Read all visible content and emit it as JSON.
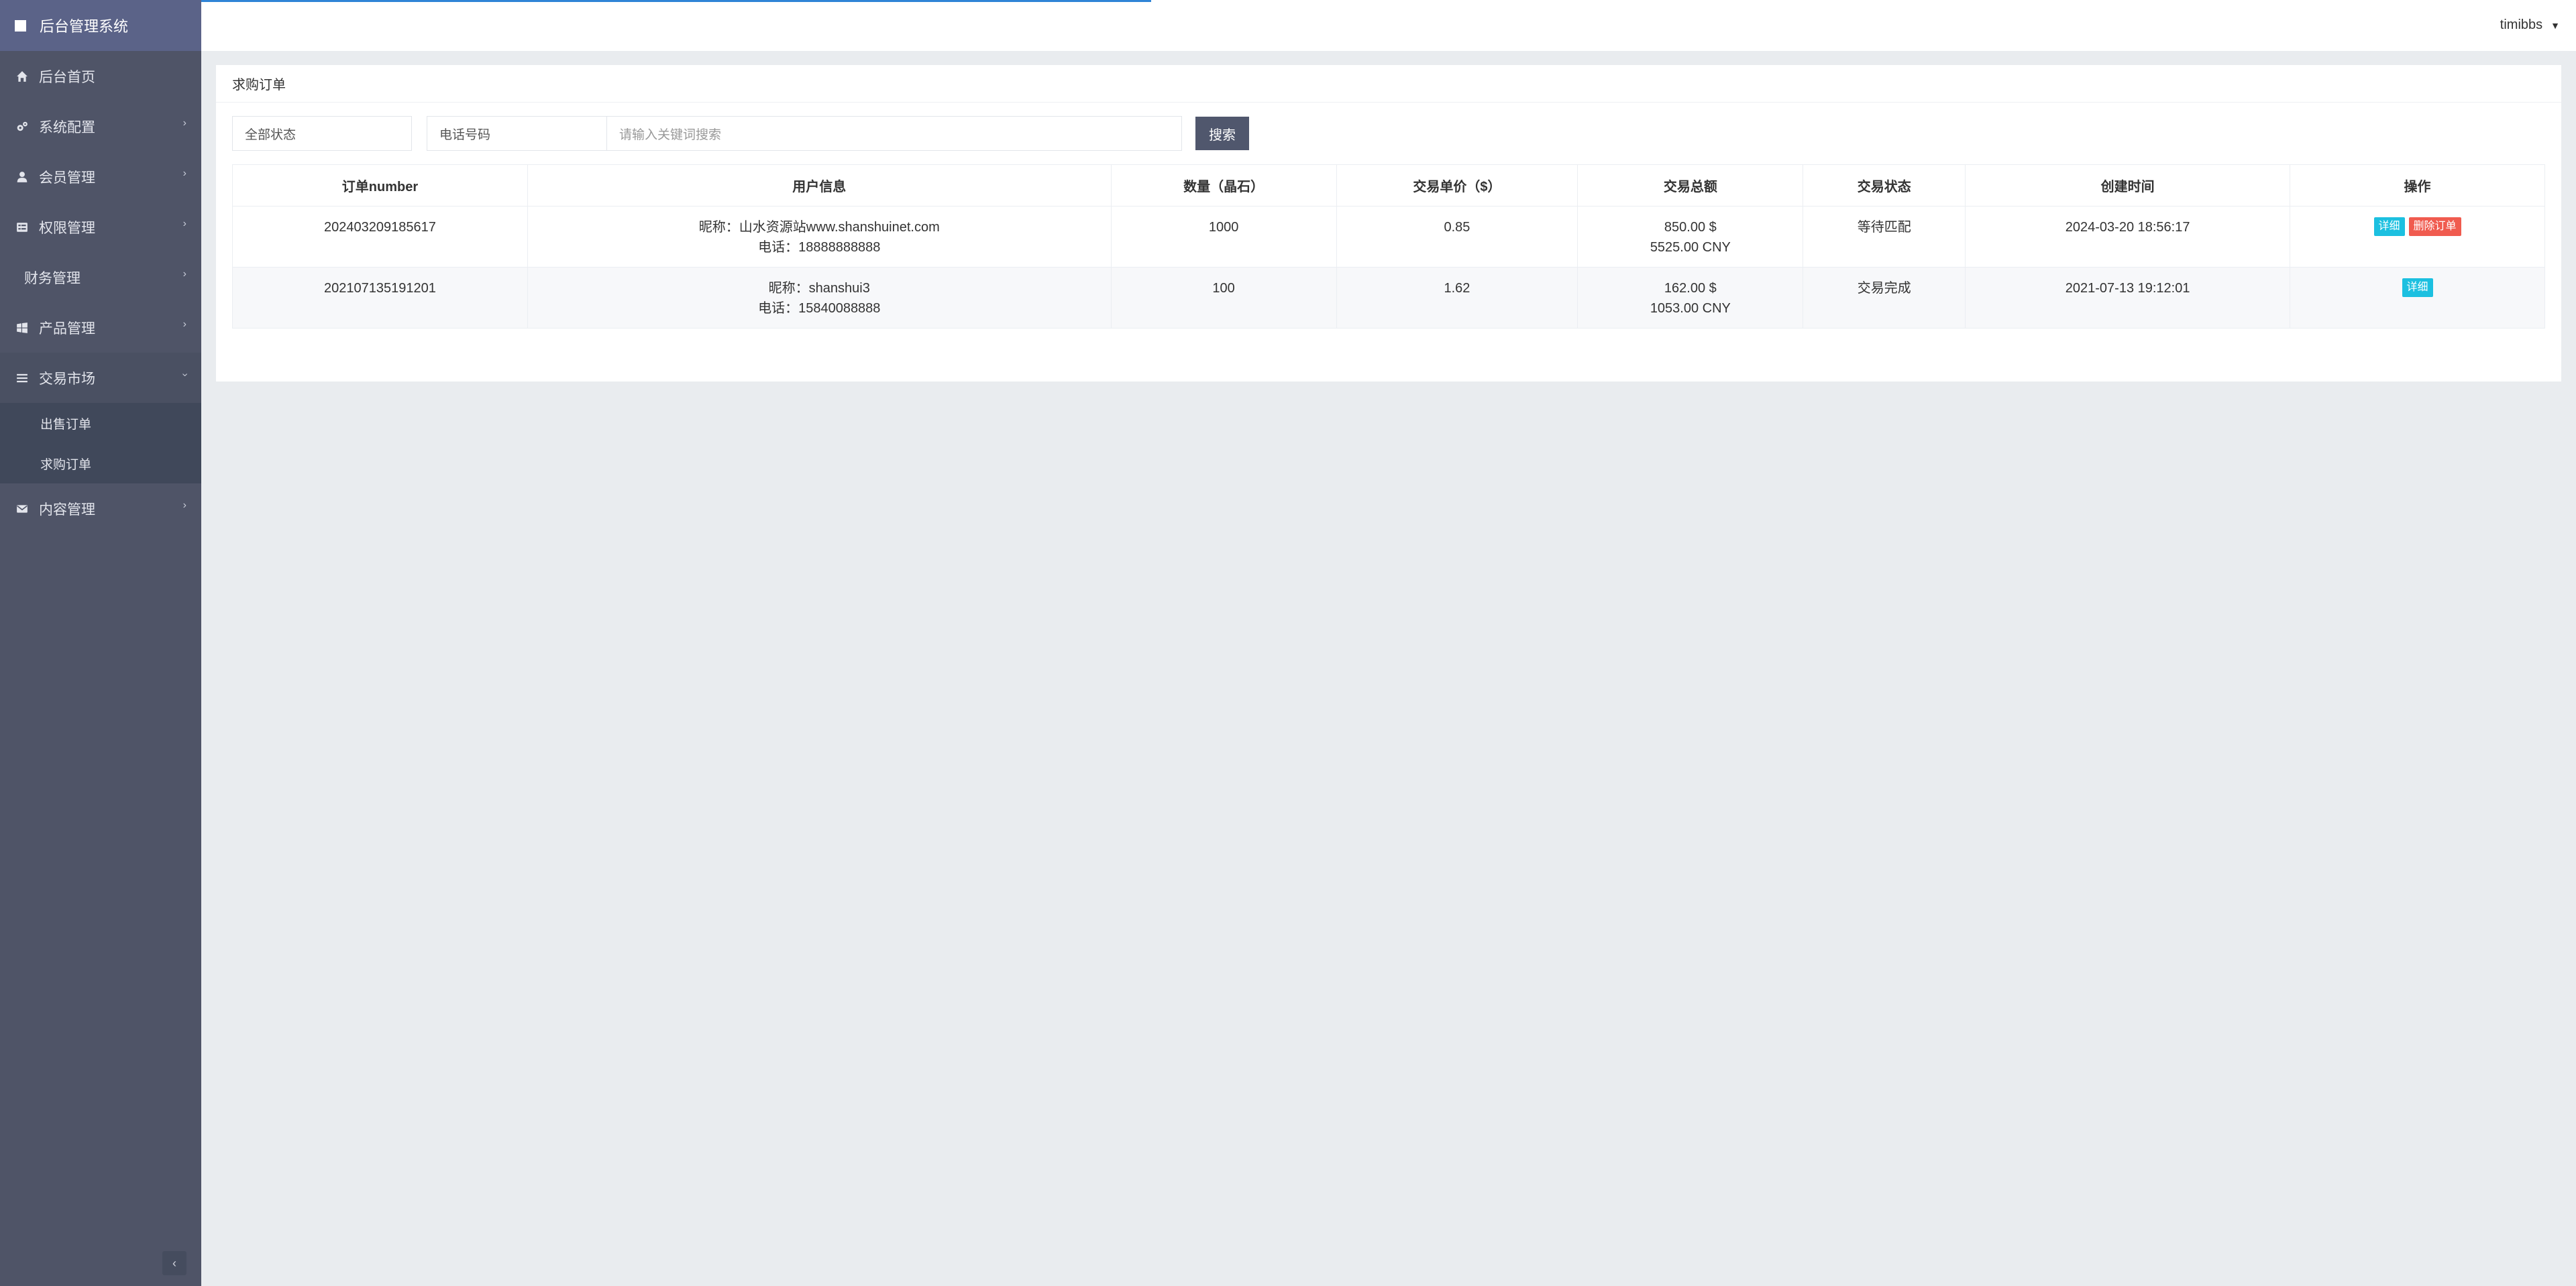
{
  "app": {
    "title": "后台管理系统"
  },
  "sidebar": {
    "items": [
      {
        "label": "后台首页",
        "icon": "home-icon"
      },
      {
        "label": "系统配置",
        "icon": "cogs-icon"
      },
      {
        "label": "会员管理",
        "icon": "user-icon"
      },
      {
        "label": "权限管理",
        "icon": "list-icon"
      },
      {
        "label": "财务管理",
        "icon": ""
      },
      {
        "label": "产品管理",
        "icon": "windows-icon"
      },
      {
        "label": "交易市场",
        "icon": "bars-icon"
      },
      {
        "label": "内容管理",
        "icon": "envelope-icon"
      }
    ],
    "submenu": [
      {
        "label": "出售订单"
      },
      {
        "label": "求购订单"
      }
    ]
  },
  "header": {
    "username": "timibbs"
  },
  "page": {
    "title": "求购订单"
  },
  "search": {
    "status_value": "全部状态",
    "phone_placeholder": "电话号码",
    "keyword_placeholder": "请输入关键词搜索",
    "button_label": "搜索"
  },
  "table": {
    "headers": [
      "订单number",
      "用户信息",
      "数量（晶石）",
      "交易单价（$）",
      "交易总额",
      "交易状态",
      "创建时间",
      "操作"
    ],
    "rows": [
      {
        "order_no": "202403209185617",
        "nickname": "昵称：山水资源站www.shanshuinet.com",
        "phone": "电话：18888888888",
        "quantity": "1000",
        "unit_price": "0.85",
        "total_usd": "850.00 $",
        "total_cny": "5525.00 CNY",
        "status": "等待匹配",
        "created": "2024-03-20 18:56:17",
        "detail_label": "详细",
        "delete_label": "删除订单"
      },
      {
        "order_no": "202107135191201",
        "nickname": "昵称：shanshui3",
        "phone": "电话：15840088888",
        "quantity": "100",
        "unit_price": "1.62",
        "total_usd": "162.00 $",
        "total_cny": "1053.00 CNY",
        "status": "交易完成",
        "created": "2021-07-13 19:12:01",
        "detail_label": "详细"
      }
    ]
  },
  "colors": {
    "sidebar_bg": "#4f5467",
    "brand_bg": "#5b6388",
    "progress": "#2f84d6",
    "detail_btn": "#1cc0e0",
    "delete_btn": "#f05b4f",
    "search_btn": "#50576d"
  },
  "progress_fraction": 0.4
}
